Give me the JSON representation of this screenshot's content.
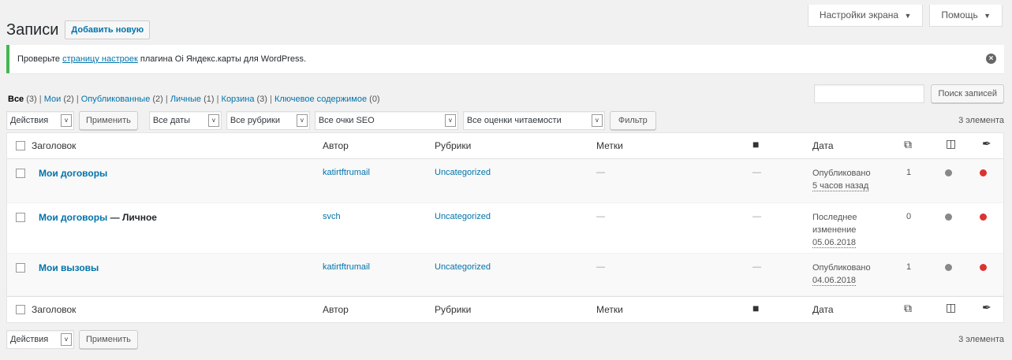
{
  "screen_options": {
    "label": "Настройки экрана",
    "arrow": "▼"
  },
  "help": {
    "label": "Помощь",
    "arrow": "▼"
  },
  "page": {
    "title": "Записи",
    "add_new": "Добавить новую"
  },
  "notice": {
    "prefix": "Проверьте ",
    "link": "страницу настроек",
    "suffix": " плагина Oi Яндекс.карты для WordPress.",
    "dismiss_icon": "dismiss-icon"
  },
  "filters": {
    "all": "Все",
    "all_count": "(3)",
    "mine": "Мои",
    "mine_count": "(2)",
    "published": "Опубликованные",
    "published_count": "(2)",
    "private": "Личные",
    "private_count": "(1)",
    "trash": "Корзина",
    "trash_count": "(3)",
    "cornerstone": "Ключевое содержимое",
    "cornerstone_count": "(0)"
  },
  "search": {
    "placeholder": "",
    "button": "Поиск записей"
  },
  "top_nav": {
    "bulk_action": "Действия",
    "apply": "Применить",
    "dates": "Все даты",
    "categories": "Все рубрики",
    "seo": "Все очки SEO",
    "readability": "Все оценки читаемости",
    "filter": "Фильтр",
    "count": "3 элемента"
  },
  "bottom_nav": {
    "bulk_action": "Действия",
    "apply": "Применить",
    "count": "3 элемента"
  },
  "columns": {
    "title": "Заголовок",
    "author": "Автор",
    "categories": "Рубрики",
    "tags": "Метки",
    "date": "Дата"
  },
  "colors": {
    "seo_dot": "#888888",
    "readability_dot": "#dc3232",
    "link": "#0073aa"
  },
  "rows": [
    {
      "title": "Мои договоры",
      "state": "",
      "author": "katirtftrumail",
      "category": "Uncategorized",
      "tags": "—",
      "comments": "—",
      "date_status": "Опубликовано",
      "date_value": "5 часов назад",
      "date_status2": "",
      "links": "1"
    },
    {
      "title": "Мои договоры",
      "state": " — Личное",
      "author": "svch",
      "category": "Uncategorized",
      "tags": "—",
      "comments": "—",
      "date_status": "Последнее",
      "date_status2": "изменение",
      "date_value": "05.06.2018",
      "links": "0"
    },
    {
      "title": "Мои вызовы",
      "state": "",
      "author": "katirtftrumail",
      "category": "Uncategorized",
      "tags": "—",
      "comments": "—",
      "date_status": "Опубликовано",
      "date_value": "04.06.2018",
      "date_status2": "",
      "links": "1"
    }
  ]
}
